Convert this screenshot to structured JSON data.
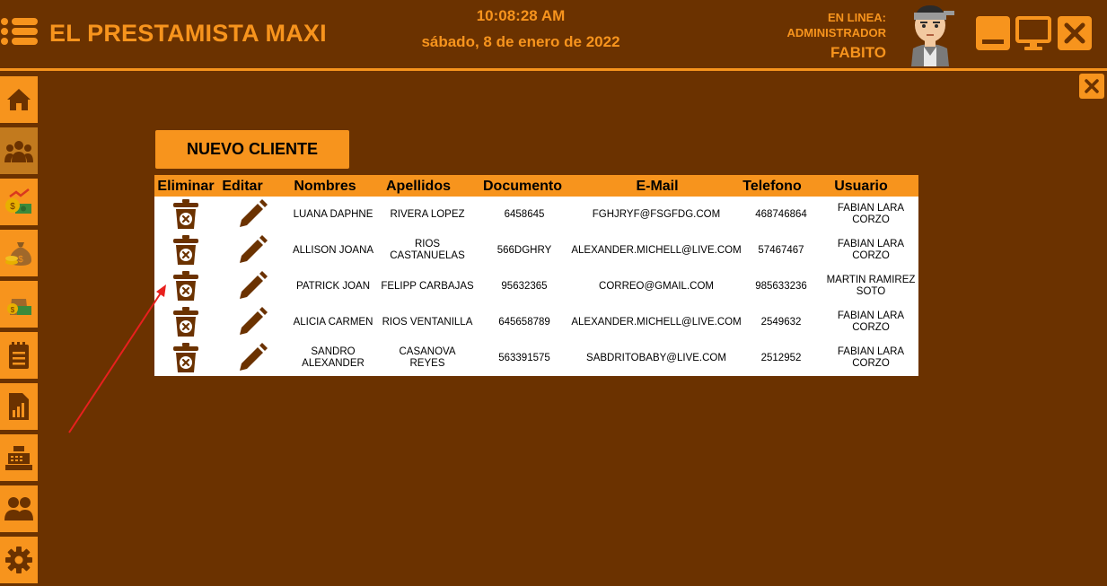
{
  "header": {
    "title": "EL PRESTAMISTA MAXI",
    "time": "10:08:28 AM",
    "date": "sábado, 8 de enero de 2022",
    "status_label": "EN LINEA:",
    "role": "ADMINISTRADOR",
    "user": "FABITO"
  },
  "sidebar": {
    "items": [
      {
        "icon": "home-icon"
      },
      {
        "icon": "users-group-icon"
      },
      {
        "icon": "money-chart-icon"
      },
      {
        "icon": "money-bag-icon"
      },
      {
        "icon": "cash-icon"
      },
      {
        "icon": "notepad-icon"
      },
      {
        "icon": "report-icon"
      },
      {
        "icon": "cash-register-icon"
      },
      {
        "icon": "users-icon"
      },
      {
        "icon": "gear-icon"
      }
    ]
  },
  "toolbar": {
    "new_client_label": "NUEVO CLIENTE"
  },
  "table": {
    "headers": [
      "Eliminar",
      "Editar",
      "Nombres",
      "Apellidos",
      "Documento",
      "E-Mail",
      "Telefono",
      "Usuario"
    ],
    "rows": [
      {
        "nombres": "LUANA DAPHNE",
        "apellidos": "RIVERA LOPEZ",
        "documento": "6458645",
        "email": "FGHJRYF@FSGFDG.COM",
        "telefono": "468746864",
        "usuario": "FABIAN LARA CORZO"
      },
      {
        "nombres": "ALLISON JOANA",
        "apellidos": "RIOS CASTANUELAS",
        "documento": "566DGHRY",
        "email": "ALEXANDER.MICHELL@LIVE.COM",
        "telefono": "57467467",
        "usuario": "FABIAN LARA CORZO"
      },
      {
        "nombres": "PATRICK JOAN",
        "apellidos": "FELIPP CARBAJAS",
        "documento": "95632365",
        "email": "CORREO@GMAIL.COM",
        "telefono": "985633236",
        "usuario": "MARTIN RAMIREZ SOTO"
      },
      {
        "nombres": "ALICIA CARMEN",
        "apellidos": "RIOS VENTANILLA",
        "documento": "645658789",
        "email": "ALEXANDER.MICHELL@LIVE.COM",
        "telefono": "2549632",
        "usuario": "FABIAN LARA CORZO"
      },
      {
        "nombres": "SANDRO ALEXANDER",
        "apellidos": "CASANOVA REYES",
        "documento": "563391575",
        "email": "SABDRITOBABY@LIVE.COM",
        "telefono": "2512952",
        "usuario": "FABIAN LARA CORZO"
      }
    ]
  },
  "colors": {
    "background": "#6b3200",
    "accent": "#f7941d",
    "icon": "#6b3200",
    "annotation_arrow": "#e8201e"
  }
}
